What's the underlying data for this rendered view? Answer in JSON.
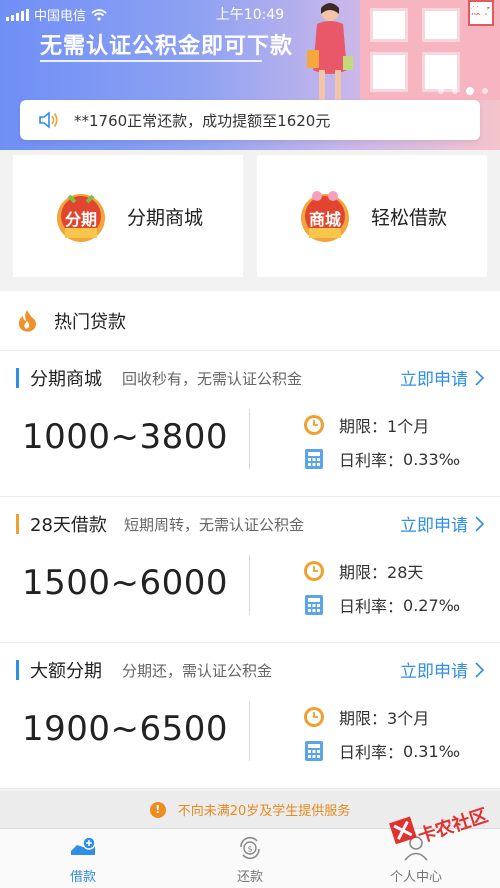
{
  "status_bar": {
    "carrier": "中国电信",
    "time": "上午10:49"
  },
  "banner": {
    "title": "无需认证公积金即可下款",
    "house_sign": "放了",
    "dots_count": 4,
    "active_dot": 3
  },
  "notice": {
    "text": "**1760正常还款，成功提额至1620元"
  },
  "quick_links": [
    {
      "badge": "分期",
      "label": "分期商城"
    },
    {
      "badge": "商城",
      "label": "轻松借款"
    }
  ],
  "hot_section": {
    "title": "热门贷款"
  },
  "loans": [
    {
      "name": "分期商城",
      "desc": "回收秒有，无需认证公积金",
      "apply": "立即申请",
      "range": "1000~3800",
      "term_label": "期限：",
      "term": "1个月",
      "rate_label": "日利率：",
      "rate": "0.33‰",
      "accent": "#2f8fe6"
    },
    {
      "name": "28天借款",
      "desc": "短期周转，无需认证公积金",
      "apply": "立即申请",
      "range": "1500~6000",
      "term_label": "期限：",
      "term": "28天",
      "rate_label": "日利率：",
      "rate": "0.27‰",
      "accent": "#f0a030"
    },
    {
      "name": "大额分期",
      "desc": "分期还，需认证公积金",
      "apply": "立即申请",
      "range": "1900~6500",
      "term_label": "期限：",
      "term": "3个月",
      "rate_label": "日利率：",
      "rate": "0.31‰",
      "accent": "#2f8fe6"
    }
  ],
  "footer_notice": {
    "icon": "!",
    "text": "不向未满20岁及学生提供服务"
  },
  "tabs": [
    {
      "label": "借款",
      "icon": "loan-icon",
      "active": true
    },
    {
      "label": "还款",
      "icon": "repay-icon",
      "active": false
    },
    {
      "label": "个人中心",
      "icon": "profile-icon",
      "active": false
    }
  ],
  "watermark": {
    "text": "卡农社区"
  },
  "colors": {
    "accent_blue": "#2f8fe6",
    "accent_orange": "#f0a030",
    "warning_orange": "#e48a1f"
  }
}
